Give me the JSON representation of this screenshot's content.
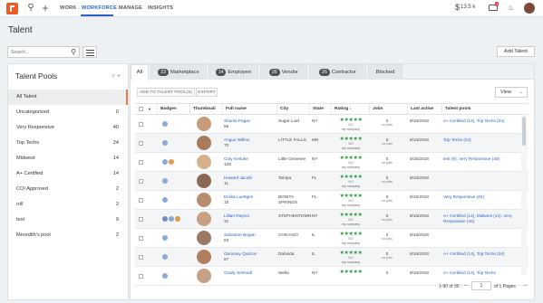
{
  "nav": {
    "links": [
      "WORK",
      "WORKFORCE",
      "MANAGE",
      "INSIGHTS"
    ],
    "active": "WORKFORCE",
    "wallet": "13.5 k",
    "mail_count": "4"
  },
  "page": {
    "title": "Talent",
    "add_button": "Add Talent"
  },
  "search": {
    "placeholder": "Search..."
  },
  "pools": {
    "title": "Talent Pools",
    "items": [
      {
        "label": "All Talent",
        "count": ""
      },
      {
        "label": "Uncategorized",
        "count": "0"
      },
      {
        "label": "Very Responsive",
        "count": "40"
      },
      {
        "label": "Top Techs",
        "count": "24"
      },
      {
        "label": "Midwest",
        "count": "14"
      },
      {
        "label": "A+ Certified",
        "count": "14"
      },
      {
        "label": "COI Approved",
        "count": "2"
      },
      {
        "label": "roll",
        "count": "2"
      },
      {
        "label": "test",
        "count": "9"
      },
      {
        "label": "Meredith's pool",
        "count": "2"
      }
    ]
  },
  "tabs": [
    {
      "label": "All",
      "count": ""
    },
    {
      "label": "Marketplace",
      "count": "23"
    },
    {
      "label": "Employee",
      "count": "14"
    },
    {
      "label": "Vendor",
      "count": "26"
    },
    {
      "label": "Contractor",
      "count": "26"
    },
    {
      "label": "Blocked",
      "count": ""
    }
  ],
  "actions": {
    "add_to_pools": "ADD TO TALENT POOL(S)",
    "export": "EXPORT",
    "view": "View"
  },
  "columns": [
    "Badges",
    "Thumbnail",
    "Full name",
    "City",
    "State",
    "Rating",
    "Jobs",
    "Last active",
    "Talent pools"
  ],
  "rows": [
    {
      "name": "Shania Pagac",
      "num": "66",
      "city": "Sugar Loaf",
      "state": "NY",
      "rating": "5.0",
      "rating_sub": "my company",
      "jobs": "0",
      "jobs_sub": "no jobs",
      "last": "8/16/2018",
      "pools": "A+ Certified (14), Top Techs (24)"
    },
    {
      "name": "Angus Willms",
      "num": "70",
      "city": "LITTLE FALLS",
      "state": "MN",
      "rating": "5.0",
      "rating_sub": "my company",
      "jobs": "0",
      "jobs_sub": "no jobs",
      "last": "8/16/2018",
      "pools": "Top Techs (24)"
    },
    {
      "name": "Coty Kerluke",
      "num": "128",
      "city": "Little Genesee",
      "state": "NY",
      "rating": "5.0",
      "rating_sub": "my company",
      "jobs": "0",
      "jobs_sub": "no jobs",
      "last": "8/16/2018",
      "pools": "test (9), Very Responsive (40)"
    },
    {
      "name": "Howard Jacobi",
      "num": "11",
      "city": "Tampa",
      "state": "FL",
      "rating": "5.0",
      "rating_sub": "my company",
      "jobs": "0",
      "jobs_sub": "no jobs",
      "last": "8/16/2018",
      "pools": ""
    },
    {
      "name": "Emilia Luettgen",
      "num": "15",
      "city": "BONITA SPRINGS",
      "state": "FL",
      "rating": "5.0",
      "rating_sub": "my company",
      "jobs": "0",
      "jobs_sub": "no jobs",
      "last": "8/16/2018",
      "pools": "Very Responsive (40)"
    },
    {
      "name": "Lillian Raynor",
      "num": "31",
      "city": "STEPHENTOWN",
      "state": "NY",
      "rating": "5.0",
      "rating_sub": "my company",
      "jobs": "0",
      "jobs_sub": "no jobs",
      "last": "8/16/2018",
      "pools": "A+ Certified (14), Midwest (14), Very Responsive (40)"
    },
    {
      "name": "Salvatore Bogan",
      "num": "63",
      "city": "CHICAGO",
      "state": "IL",
      "rating": "5.0",
      "rating_sub": "my company",
      "jobs": "0",
      "jobs_sub": "no jobs",
      "last": "8/16/2018",
      "pools": ""
    },
    {
      "name": "Geovany Quitzon",
      "num": "67",
      "city": "Dahinda",
      "state": "IL",
      "rating": "5.0",
      "rating_sub": "my company",
      "jobs": "0",
      "jobs_sub": "no jobs",
      "last": "8/16/2018",
      "pools": "A+ Certified (14), Top Techs (24)"
    },
    {
      "name": "Grady Schmidt",
      "num": "",
      "city": "Stella",
      "state": "NY",
      "rating": "",
      "rating_sub": "",
      "jobs": "0",
      "jobs_sub": "",
      "last": "8/16/2018",
      "pools": "A+ Certified (14), Top Techs"
    }
  ],
  "pager": {
    "range": "1-90 of 90",
    "page": "1",
    "of_pages": "of 1 Pages"
  },
  "colors": {
    "brand": "#ee5a24",
    "link": "#2b62c5",
    "star": "#2e9a3e"
  }
}
